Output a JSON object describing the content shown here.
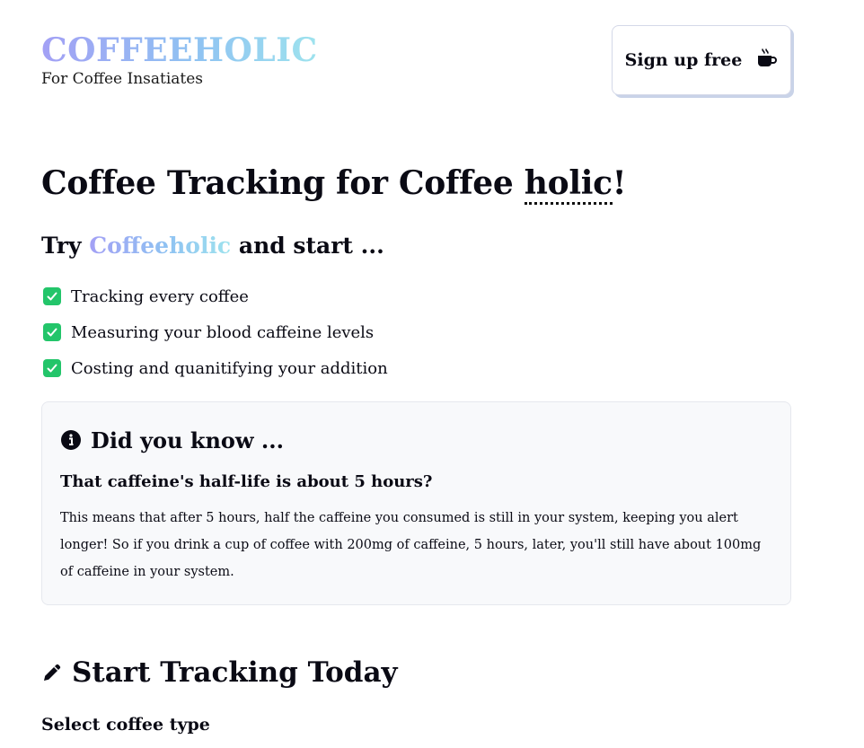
{
  "brand": {
    "title": "COFFEEHOLIC",
    "tagline": "For Coffee Insatiates"
  },
  "header": {
    "signup_label": "Sign up free",
    "signup_icon": "mug-hot-icon"
  },
  "hero": {
    "title_prefix": "Coffee Tracking for Coffee ",
    "title_emphasis": "holic",
    "title_suffix": "!",
    "try_prefix": "Try ",
    "try_brand": "Coffeeholic",
    "try_suffix": " and start ..."
  },
  "features": [
    {
      "label": "Tracking every coffee",
      "icon": "check-square-icon"
    },
    {
      "label": "Measuring your blood caffeine levels",
      "icon": "check-square-icon"
    },
    {
      "label": "Costing and quanitifying your addition",
      "icon": "check-square-icon"
    }
  ],
  "did_you_know": {
    "heading": "Did you know ...",
    "question": "That caffeine's half-life is about 5 hours?",
    "body": "This means that after 5 hours, half the caffeine you consumed is still in your system, keeping you alert longer! So if you drink a cup of coffee with 200mg of caffeine, 5 hours, later, you'll still have about 100mg of caffeine in your system."
  },
  "tracking": {
    "heading": "Start Tracking Today",
    "select_label": "Select coffee type"
  },
  "colors": {
    "brand_gradient_start": "#a3a0f5",
    "brand_gradient_end": "#9ee3ee",
    "check_green": "#23c56a",
    "card_bg": "#f8f9fb"
  }
}
